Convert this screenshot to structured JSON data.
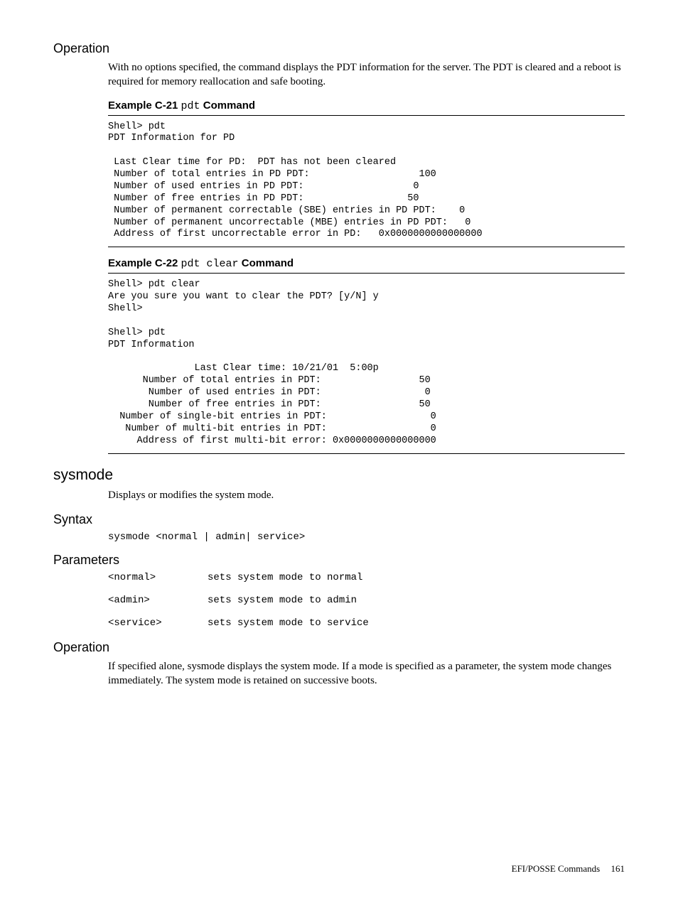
{
  "sections": {
    "operation1": {
      "heading": "Operation",
      "text": "With no options specified, the command displays the PDT information for the server. The PDT is cleared and a reboot is required for memory reallocation and safe booting."
    },
    "example_c21": {
      "label_prefix": "Example C-21 ",
      "cmd": "pdt",
      "label_suffix": " Command",
      "code": "Shell> pdt\nPDT Information for PD\n\n Last Clear time for PD:  PDT has not been cleared\n Number of total entries in PD PDT:                   100\n Number of used entries in PD PDT:                   0\n Number of free entries in PD PDT:                  50\n Number of permanent correctable (SBE) entries in PD PDT:    0\n Number of permanent uncorrectable (MBE) entries in PD PDT:   0\n Address of first uncorrectable error in PD:   0x0000000000000000"
    },
    "example_c22": {
      "label_prefix": "Example C-22 ",
      "cmd": "pdt clear",
      "label_suffix": " Command",
      "code": "Shell> pdt clear\nAre you sure you want to clear the PDT? [y/N] y\nShell>\n\nShell> pdt\nPDT Information\n\n               Last Clear time: 10/21/01  5:00p\n      Number of total entries in PDT:                 50\n       Number of used entries in PDT:                  0\n       Number of free entries in PDT:                 50\n  Number of single-bit entries in PDT:                  0\n   Number of multi-bit entries in PDT:                  0\n     Address of first multi-bit error: 0x0000000000000000"
    },
    "sysmode": {
      "heading": "sysmode",
      "desc": "Displays or modifies the system mode."
    },
    "syntax": {
      "heading": "Syntax",
      "line": "sysmode <normal | admin| service>"
    },
    "parameters": {
      "heading": "Parameters",
      "rows": [
        {
          "key": "<normal>",
          "val": "sets system mode to normal"
        },
        {
          "key": "<admin>",
          "val": "sets system mode to admin"
        },
        {
          "key": "<service>",
          "val": "sets system mode to service"
        }
      ]
    },
    "operation2": {
      "heading": "Operation",
      "text": "If specified alone, sysmode displays the system mode. If a mode is specified as a parameter, the system mode changes immediately. The system mode is retained on successive boots."
    }
  },
  "footer": {
    "section": "EFI/POSSE Commands",
    "page": "161"
  }
}
